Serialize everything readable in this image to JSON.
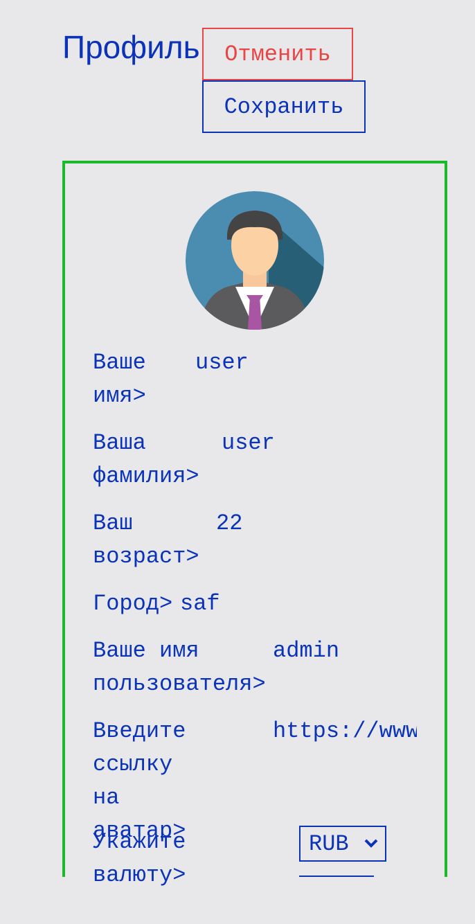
{
  "header": {
    "title": "Профиль",
    "cancel_label": "Отменить",
    "save_label": "Сохранить"
  },
  "profile": {
    "avatar_icon": "user-avatar-icon",
    "fields": [
      {
        "label_lines": [
          "Ваше",
          "имя>"
        ],
        "value": "user"
      },
      {
        "label_lines": [
          "Ваша",
          "фамилия>"
        ],
        "value": "user"
      },
      {
        "label_lines": [
          "Ваш",
          "возраст>"
        ],
        "value": "22"
      },
      {
        "label_lines": [
          "Город>"
        ],
        "value": "saf"
      },
      {
        "label_lines": [
          "Ваше имя",
          "пользователя>"
        ],
        "value": "admin"
      },
      {
        "label_lines": [
          "Введите",
          "ссылку на",
          "аватар>"
        ],
        "value": "https://www"
      }
    ],
    "currency": {
      "label": "Укажите валюту>",
      "selected": "RUB"
    }
  },
  "colors": {
    "background": "#e8e7ea",
    "text": "#0a33b8",
    "cancel": "#e84545",
    "card_border": "#1db92a"
  }
}
